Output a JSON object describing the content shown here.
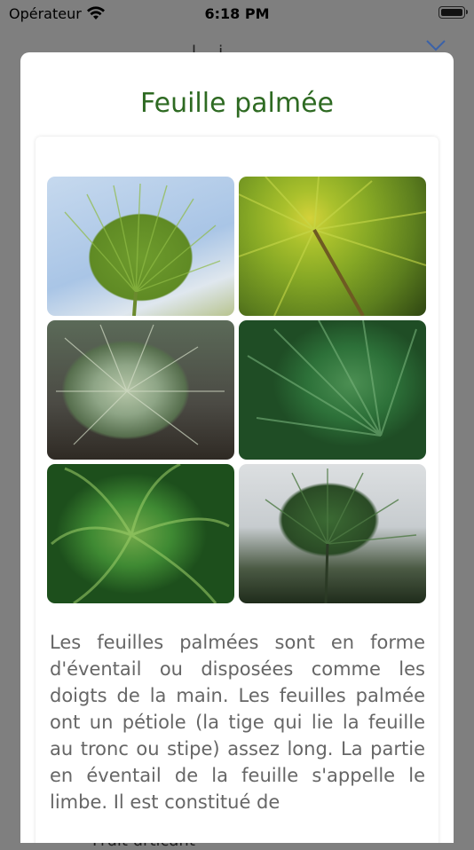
{
  "status_bar": {
    "carrier": "Opérateur",
    "time": "6:18 PM"
  },
  "background": {
    "title_fragment": "l . i",
    "row_label": "Fruit urticant"
  },
  "modal": {
    "title": "Feuille palmée",
    "photos": [
      {
        "name": "palm-leaf-photo-1"
      },
      {
        "name": "palm-leaf-photo-2"
      },
      {
        "name": "palm-leaf-photo-3"
      },
      {
        "name": "palm-leaf-photo-4"
      },
      {
        "name": "palm-leaf-photo-5"
      },
      {
        "name": "palm-leaf-photo-6"
      }
    ],
    "description": "Les feuilles palmées sont en forme d'éventail ou disposées comme les doigts de la main. Les feuilles palmée ont un pétiole (la tige qui lie la feuille au tronc ou stipe) assez long. La partie en éventail de la feuille s'appelle le limbe. Il est constitué de"
  },
  "colors": {
    "title": "#2e6a22",
    "text": "#666666",
    "overlay": "#7f7f7f"
  }
}
